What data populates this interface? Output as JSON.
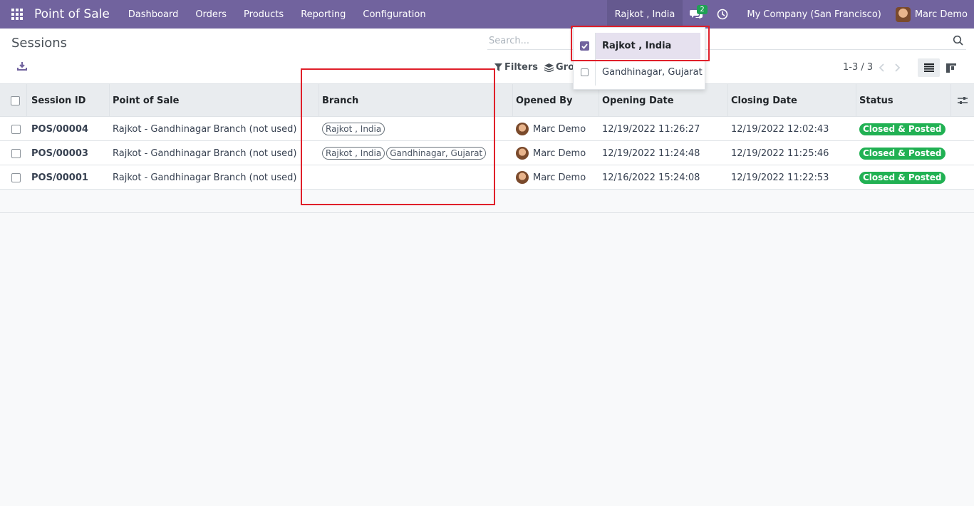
{
  "navbar": {
    "app_title": "Point of Sale",
    "menus": [
      "Dashboard",
      "Orders",
      "Products",
      "Reporting",
      "Configuration"
    ],
    "current_branch": "Rajkot , India",
    "messages_count": "2",
    "company": "My Company (San Francisco)",
    "user": "Marc Demo",
    "accent_color": "#71639e"
  },
  "control_panel": {
    "breadcrumb": "Sessions",
    "search_placeholder": "Search...",
    "filters_label": "Filters",
    "groupby_label": "Grou",
    "pager": "1-3 / 3"
  },
  "branch_dropdown": {
    "items": [
      {
        "label": "Rajkot , India",
        "checked": true
      },
      {
        "label": "Gandhinagar, Gujarat",
        "checked": false
      }
    ]
  },
  "table": {
    "columns": [
      "Session ID",
      "Point of Sale",
      "Branch",
      "Opened By",
      "Opening Date",
      "Closing Date",
      "Status"
    ],
    "rows": [
      {
        "session_id": "POS/00004",
        "pos": "Rajkot - Gandhinagar Branch (not used)",
        "branches": [
          "Rajkot , India"
        ],
        "opened_by": "Marc Demo",
        "opening_date": "12/19/2022 11:26:27",
        "closing_date": "12/19/2022 12:02:43",
        "status": "Closed & Posted"
      },
      {
        "session_id": "POS/00003",
        "pos": "Rajkot - Gandhinagar Branch (not used)",
        "branches": [
          "Rajkot , India",
          "Gandhinagar, Gujarat"
        ],
        "opened_by": "Marc Demo",
        "opening_date": "12/19/2022 11:24:48",
        "closing_date": "12/19/2022 11:25:46",
        "status": "Closed & Posted"
      },
      {
        "session_id": "POS/00001",
        "pos": "Rajkot - Gandhinagar Branch (not used)",
        "branches": [],
        "opened_by": "Marc Demo",
        "opening_date": "12/16/2022 15:24:08",
        "closing_date": "12/19/2022 11:22:53",
        "status": "Closed & Posted"
      }
    ],
    "status_color": "#21b153"
  },
  "icons": [
    "apps-icon",
    "chat-icon",
    "clock-icon",
    "download-icon",
    "search-icon",
    "filter-icon",
    "layers-icon",
    "chevron-left-icon",
    "chevron-right-icon",
    "list-view-icon",
    "kanban-view-icon",
    "optional-columns-icon"
  ]
}
